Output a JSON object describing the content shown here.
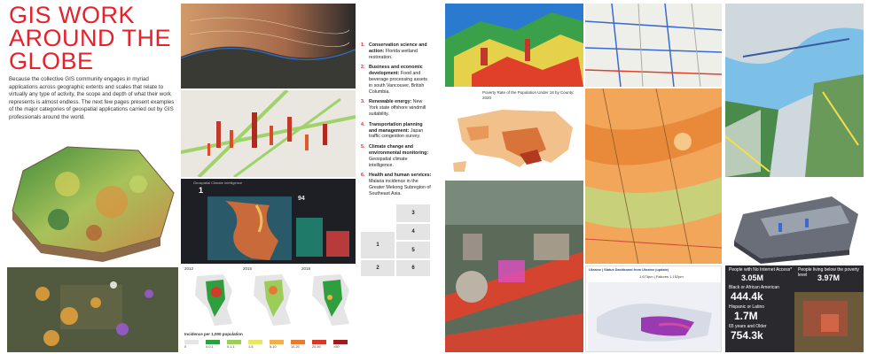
{
  "page": {
    "title": "GIS WORK AROUND THE GLOBE",
    "intro": "Because the collective GIS community engages in myriad applications across geographic extents and scales that relate to virtually any type of activity, the scope and depth of what their work represents is almost endless. The next few pages present examples of the major categories of geospatial applications carried out by GIS professionals around the world."
  },
  "categories": [
    {
      "num": "1.",
      "head": "Conservation science and action:",
      "body": "Florida wetland restoration."
    },
    {
      "num": "2.",
      "head": "Business and economic development:",
      "body": "Food and beverage processing assets in south Vancouver, British Columbia."
    },
    {
      "num": "3.",
      "head": "Renewable energy:",
      "body": "New York state offshore windmill suitability."
    },
    {
      "num": "4.",
      "head": "Transportation planning and management:",
      "body": "Japan traffic congestion survey."
    },
    {
      "num": "5.",
      "head": "Climate change and environmental monitoring:",
      "body": "Geospatial climate intelligence."
    },
    {
      "num": "6.",
      "head": "Health and human services:",
      "body": "Malaria incidence in the Greater Mekong Subregion of Southeast Asia."
    }
  ],
  "number_grid": [
    "3",
    "4",
    "1",
    "5",
    "2",
    "6"
  ],
  "malaria": {
    "years": [
      "2012",
      "2015",
      "2018"
    ],
    "legend_title": "Incidence per 1,000 population",
    "legend_items": [
      "0",
      "0-0.1",
      "0.1-1",
      "1-5",
      "5-10",
      "10-20",
      "20-50",
      ">50"
    ],
    "legend_colors": [
      "#e5e5e5",
      "#2e9e3e",
      "#9ccc5a",
      "#e9e56a",
      "#f1b04a",
      "#e57a36",
      "#d23a2a",
      "#9c1b1b"
    ]
  },
  "poverty_map": {
    "title": "Poverty Rate of the Population Under 18 by County: 2020"
  },
  "dashboard": {
    "header": "Geospatial Climate Intelligence",
    "kpi_main": "1"
  },
  "ukraine": {
    "header": "Ukraine | Status Dashboard from Ukraine (update)",
    "stats": "1,673pm | Failures 1,152pm"
  },
  "census": {
    "items": [
      {
        "label": "People with No Internet Access*",
        "value": "3.05M"
      },
      {
        "label": "People living below the poverty level",
        "value": "3.97M"
      },
      {
        "label": "Black or African American",
        "value": "444.4k"
      },
      {
        "label": "Hispanic or Latino",
        "value": "1.7M"
      },
      {
        "label": "65 years and Older",
        "value": "754.3k"
      }
    ]
  },
  "colors": {
    "accent": "#e8202a",
    "dark_panel": "#1d1f24"
  }
}
